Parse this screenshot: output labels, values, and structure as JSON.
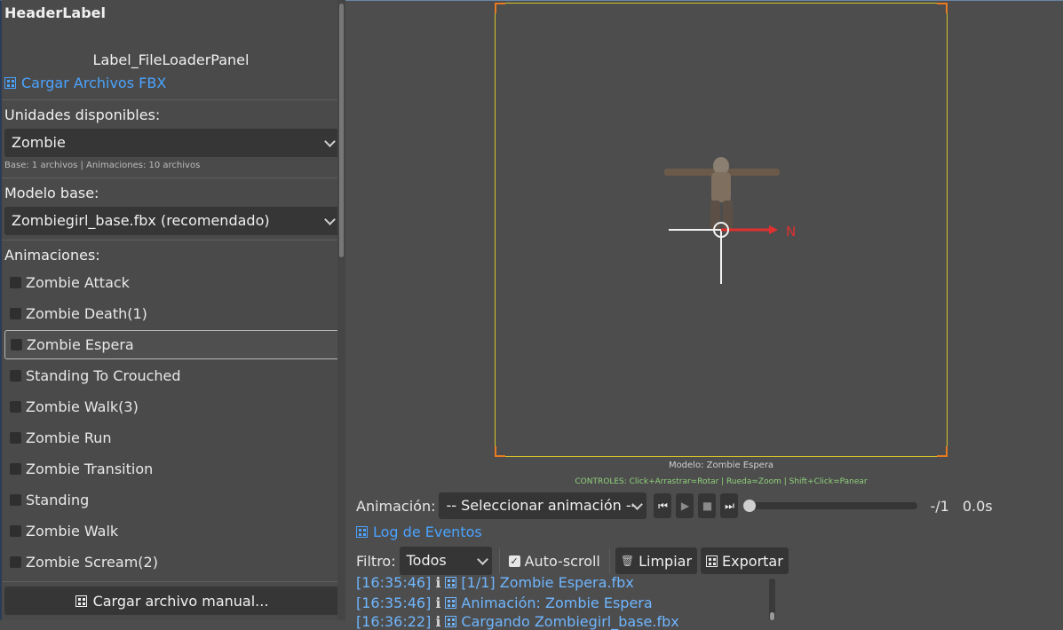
{
  "left_panel": {
    "header_label": "HeaderLabel",
    "file_loader_label": "Label_FileLoaderPanel",
    "load_fbx_link": "Cargar Archivos FBX",
    "units_label": "Unidades disponibles:",
    "unit_selected": "Zombie",
    "unit_info": "Base: 1 archivos | Animaciones: 10 archivos",
    "base_model_label": "Modelo base:",
    "base_model_selected": "Zombiegirl_base.fbx (recomendado)",
    "animations_label": "Animaciones:",
    "animations": [
      "Zombie Attack",
      "Zombie Death(1)",
      "Zombie Espera",
      "Standing To Crouched",
      "Zombie Walk(3)",
      "Zombie Run",
      "Zombie Transition",
      "Standing",
      "Zombie Walk",
      "Zombie Scream(2)"
    ],
    "selected_animation_index": 2,
    "manual_load_button": "Cargar archivo manual..."
  },
  "viewport": {
    "north_label": "N",
    "model_caption": "Modelo: Zombie Espera",
    "controls_caption": "CONTROLES: Click+Arrastrar=Rotar | Rueda=Zoom | Shift+Click=Panear",
    "controls_caption_color": "#8fd17a",
    "frame_color": "#d6c52a",
    "corner_color": "#e87a20",
    "arrow_color": "#e03030"
  },
  "animation_bar": {
    "label": "Animación:",
    "select_value": "-- Seleccionar animación --",
    "frame_counter": "-/1",
    "time": "0.0s",
    "progress": 0
  },
  "log": {
    "title": "Log de Eventos",
    "filter_label": "Filtro:",
    "filter_value": "Todos",
    "autoscroll_label": "Auto-scroll",
    "autoscroll_checked": true,
    "clear_button": "Limpiar",
    "export_button": "Exportar",
    "entries": [
      {
        "time": "[16:35:46]",
        "text": "[1/1] Zombie Espera.fbx"
      },
      {
        "time": "[16:35:46]",
        "text": "Animación: Zombie Espera"
      },
      {
        "time": "[16:36:22]",
        "text": "Cargando Zombiegirl_base.fbx"
      }
    ]
  },
  "accent_color": "#4aa3ff"
}
